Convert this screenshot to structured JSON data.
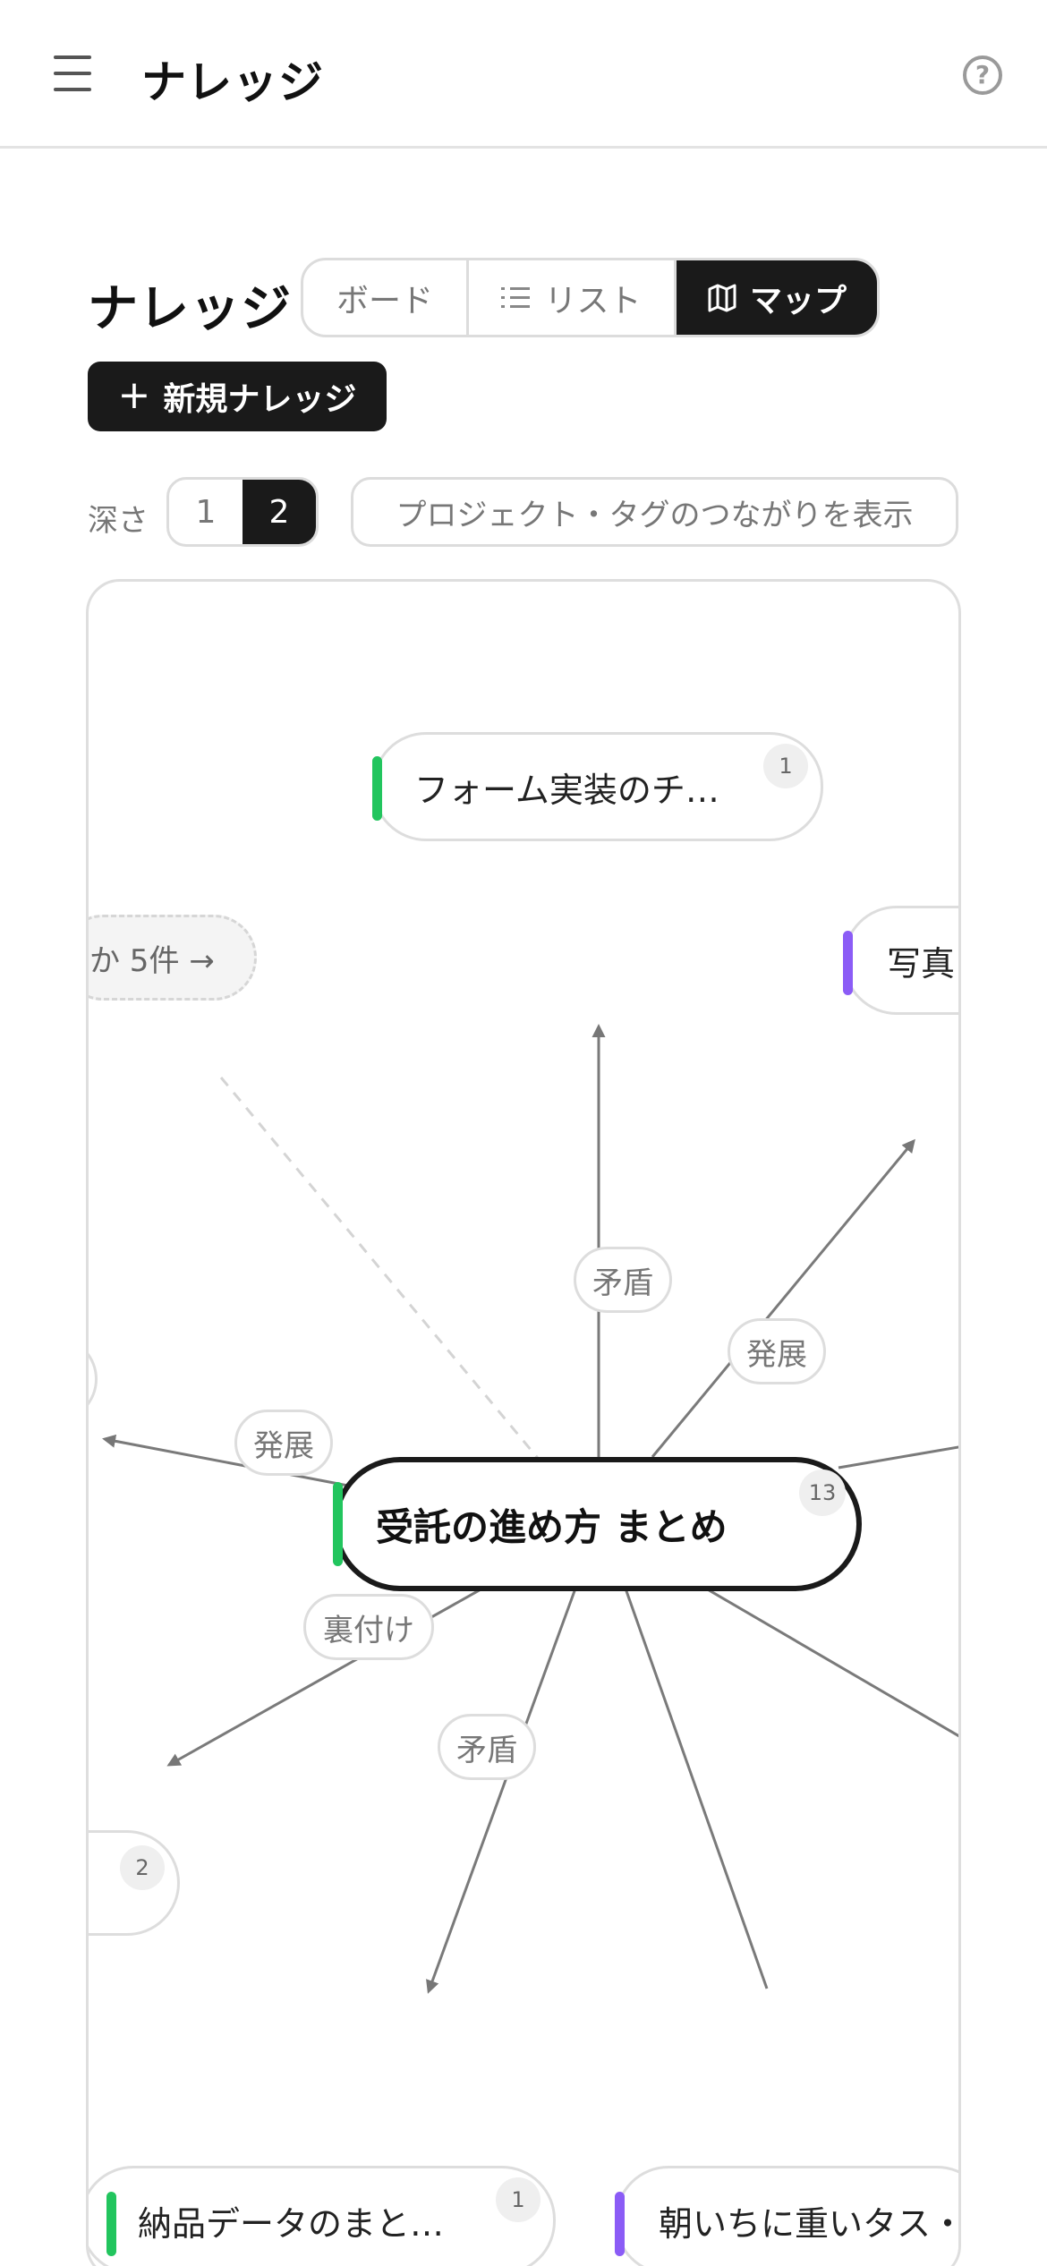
{
  "header": {
    "title": "ナレッジ",
    "menu_icon": "hamburger-menu-icon",
    "help_icon": "help-icon",
    "help_glyph": "?"
  },
  "page": {
    "title": "ナレッジ"
  },
  "view_tabs": {
    "board": "ボード",
    "list": "リスト",
    "map": "マップ",
    "active": "map"
  },
  "new_button": {
    "plus": "+",
    "label": "新規ナレッジ"
  },
  "depth": {
    "label": "深さ",
    "options": [
      "1",
      "2"
    ],
    "selected": "2"
  },
  "connections_button": "プロジェクト・タグのつながりを表示",
  "colors": {
    "accent_dark": "#1a1a1a",
    "tag_green": "#22c55e",
    "tag_purple": "#8b5cf6"
  },
  "map": {
    "center": {
      "title": "受託の進め方 まとめ",
      "count": "13",
      "color": "#22c55e"
    },
    "nodes": [
      {
        "label": "フォーム実装のチ…",
        "count": "1",
        "color": "#22c55e"
      },
      {
        "label": "写真",
        "color": "#8b5cf6"
      },
      {
        "label": "",
        "count": "2"
      },
      {
        "label": "納品データのまと…",
        "count": "1",
        "color": "#22c55e"
      },
      {
        "label": "朝いちに重いタス・",
        "color": "#8b5cf6"
      }
    ],
    "more": "か 5件 →",
    "edge_labels": [
      "矛盾",
      "発展",
      "発展",
      "裏付け",
      "矛盾"
    ]
  }
}
